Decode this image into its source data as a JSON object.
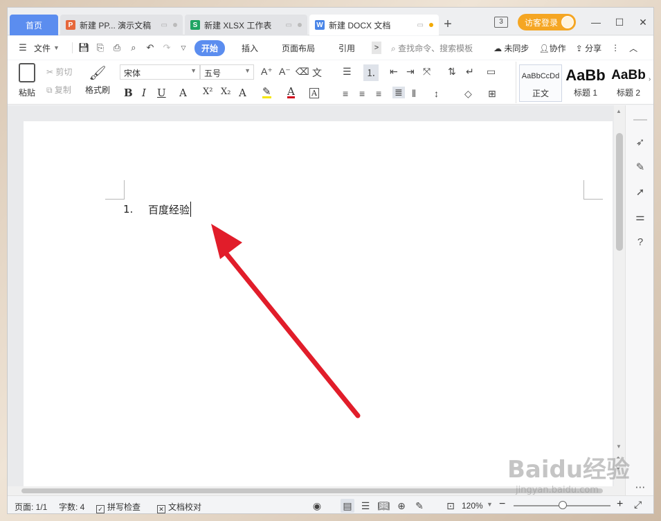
{
  "tabs": [
    {
      "label": "首页",
      "kind": "home"
    },
    {
      "label": "新建 PP... 演示文稿",
      "badge": "P",
      "badge_color": "#e6673b"
    },
    {
      "label": "新建 XLSX 工作表",
      "badge": "S",
      "badge_color": "#1fa463"
    },
    {
      "label": "新建 DOCX 文档",
      "badge": "W",
      "badge_color": "#4a86e8",
      "active": true
    }
  ],
  "titlebar": {
    "new_tab": "+",
    "window_count": "3",
    "login": "访客登录",
    "minimize": "—",
    "maximize": "☐",
    "close": "✕"
  },
  "menu": {
    "file": "文件",
    "ribbon_tabs": [
      "开始",
      "插入",
      "页面布局",
      "引用"
    ],
    "more": ">",
    "search": "查找命令、搜索模板",
    "sync": "未同步",
    "collab": "协作",
    "share": "分享"
  },
  "ribbon": {
    "paste": "粘贴",
    "cut": "剪切",
    "copy": "复制",
    "format_painter": "格式刷",
    "font_name": "宋体",
    "font_size": "五号",
    "styles": [
      {
        "preview": "AaBbCcDd",
        "name": "正文"
      },
      {
        "preview": "AaBb",
        "name": "标题 1"
      },
      {
        "preview": "AaBb",
        "name": "标题 2"
      }
    ]
  },
  "document": {
    "list_number": "1.",
    "text": "百度经验"
  },
  "status": {
    "page": "页面: 1/1",
    "words": "字数: 4",
    "spell": "拼写检查",
    "proof": "文档校对",
    "zoom": "120%"
  },
  "watermark": {
    "brand": "Baidu经验",
    "url": "jingyan.baidu.com"
  },
  "colors": {
    "accent": "#5b8def",
    "login": "#f5a623",
    "arrow": "#e11d2a"
  }
}
